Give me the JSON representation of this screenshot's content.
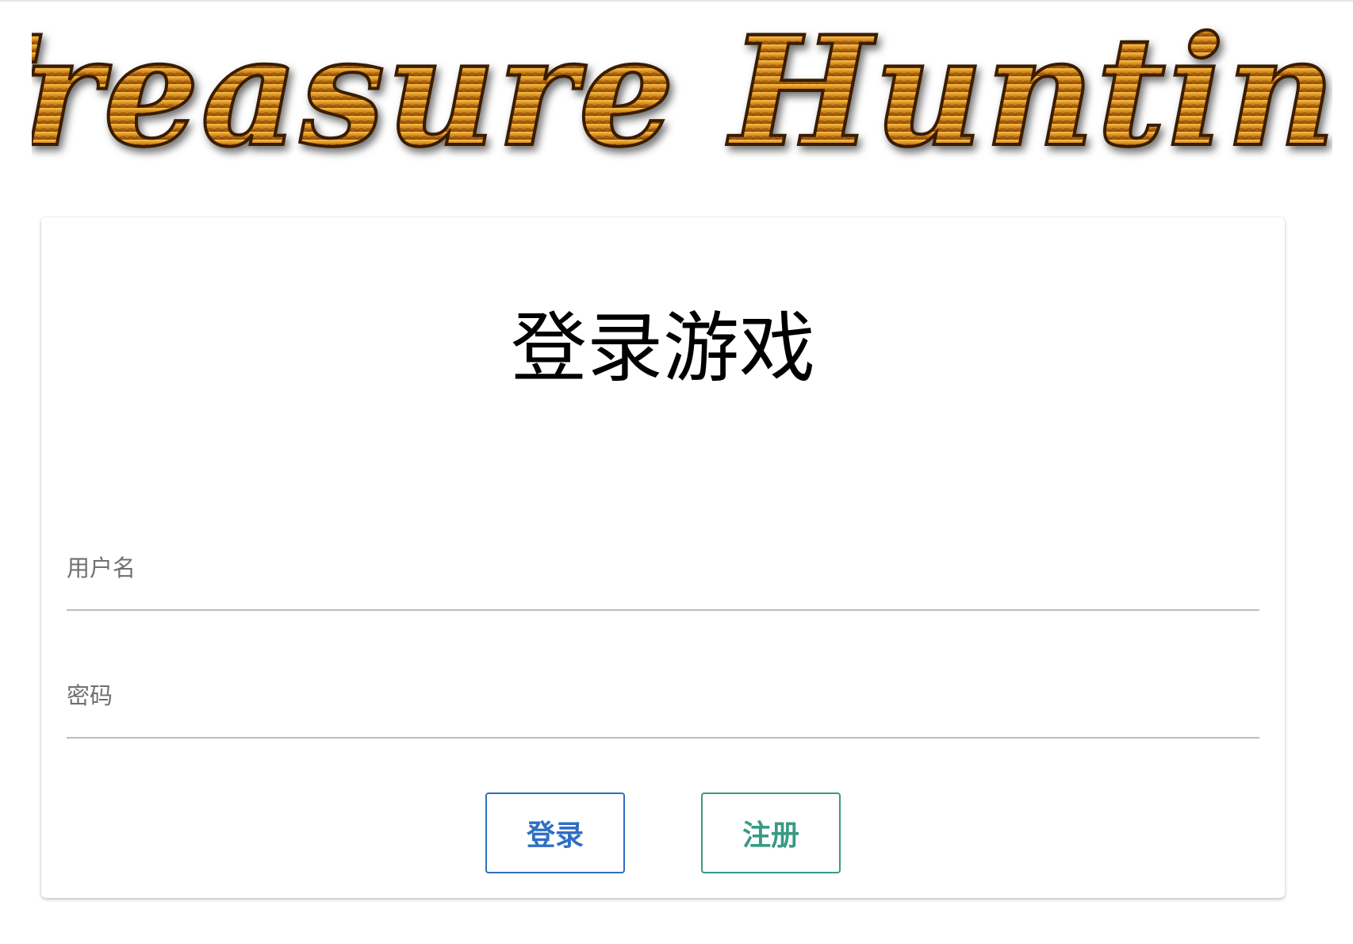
{
  "logo": {
    "text": "Treasure Hunting",
    "colors": {
      "gold": "#d98a1c",
      "gold_light": "#f2b33d",
      "shadow": "#3a1f05"
    }
  },
  "login_card": {
    "title": "登录游戏",
    "username_field": {
      "label": "用户名",
      "value": ""
    },
    "password_field": {
      "label": "密码",
      "value": ""
    },
    "login_button": {
      "label": "登录",
      "color": "#2f6fc4"
    },
    "register_button": {
      "label": "注册",
      "color": "#3a9a86"
    }
  }
}
